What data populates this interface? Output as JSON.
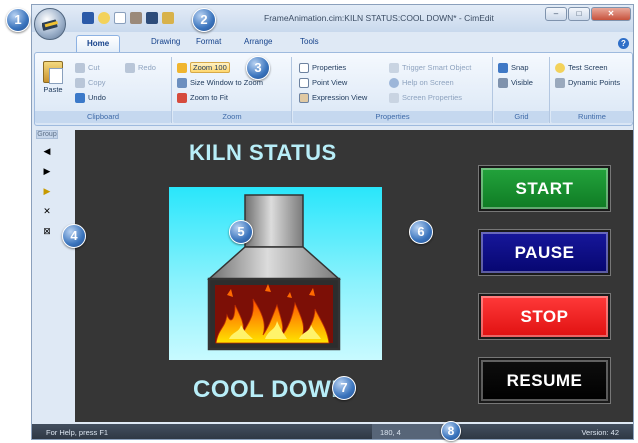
{
  "window": {
    "title": "FrameAnimation.cim:KILN STATUS:COOL DOWN* - CimEdit",
    "controls": {
      "minimize": "–",
      "maximize": "□",
      "close": "✕"
    }
  },
  "tabs": [
    "Home",
    "Drawing",
    "Format",
    "Arrange",
    "Tools"
  ],
  "active_tab": "Home",
  "ribbon": {
    "clipboard": {
      "label": "Clipboard",
      "paste": "Paste",
      "cut": "Cut",
      "copy": "Copy",
      "redo": "Redo",
      "undo": "Undo"
    },
    "zoom": {
      "label": "Zoom",
      "zoom_value": "Zoom 100",
      "size_window": "Size Window to Zoom",
      "zoom_to_fit": "Zoom to Fit"
    },
    "properties": {
      "label": "Properties",
      "properties": "Properties",
      "point_view": "Point View",
      "expression_view": "Expression View",
      "trigger": "Trigger Smart Object",
      "help_on_screen": "Help on Screen",
      "screen_properties": "Screen Properties"
    },
    "grid": {
      "label": "Grid",
      "snap": "Snap",
      "visible": "Visible"
    },
    "runtime": {
      "label": "Runtime",
      "test_screen": "Test Screen",
      "dynamic_points": "Dynamic Points"
    }
  },
  "left_toolbar": {
    "label": "Group",
    "buttons": [
      "◀",
      "▶",
      "▶",
      "✕",
      "⊠"
    ]
  },
  "canvas": {
    "title": "KILN STATUS",
    "state": "COOL DOWN",
    "buttons": [
      "START",
      "PAUSE",
      "STOP",
      "RESUME"
    ]
  },
  "statusbar": {
    "help": "For Help, press F1",
    "coords": "180, 4",
    "version": "Version: 42"
  },
  "callouts": [
    "1",
    "2",
    "3",
    "4",
    "5",
    "6",
    "7",
    "8"
  ],
  "colors": {
    "start": "#1b8f2f",
    "pause": "#0a0a80",
    "stop": "#ff2a2a",
    "resume": "#000000",
    "canvas_bg": "#363636",
    "panel_top": "#29e6fb",
    "title_text": "#b8eef8"
  },
  "icons": [
    "app-orb-icon",
    "save-icon",
    "new-icon",
    "open-icon",
    "print-icon",
    "paste-icon",
    "cut-icon",
    "copy-icon",
    "redo-icon",
    "undo-icon",
    "zoom-icon",
    "help-icon"
  ]
}
